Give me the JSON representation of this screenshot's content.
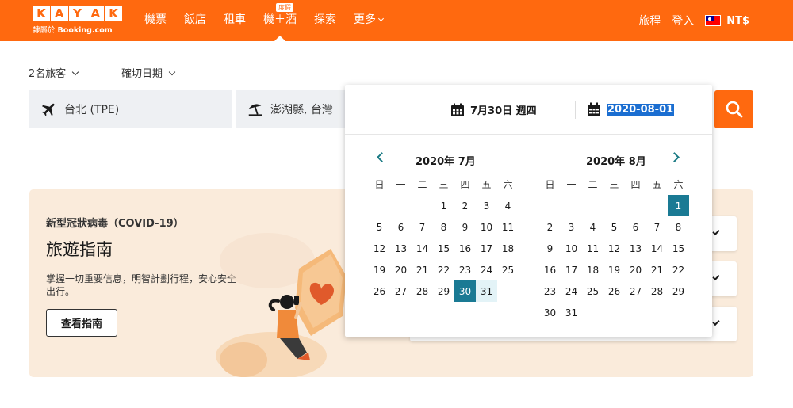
{
  "header": {
    "logo_letters": [
      "K",
      "A",
      "Y",
      "A",
      "K"
    ],
    "logo_sub_prefix": "隸屬於",
    "logo_sub_brand": "Booking.com",
    "nav": [
      {
        "label": "機票",
        "name": "nav-flights"
      },
      {
        "label": "飯店",
        "name": "nav-hotels"
      },
      {
        "label": "租車",
        "name": "nav-cars"
      },
      {
        "label": "機＋酒",
        "name": "nav-packages",
        "badge": "度假",
        "active": true
      },
      {
        "label": "探索",
        "name": "nav-explore"
      },
      {
        "label": "更多",
        "name": "nav-more",
        "dropdown": true
      }
    ],
    "trips": "旅程",
    "login": "登入",
    "currency": "NT$",
    "brand_color": "#ff690f"
  },
  "options": {
    "travelers": "2名旅客",
    "exact_dates": "確切日期"
  },
  "search": {
    "origin": "台北 (TPE)",
    "destination": "澎湖縣, 台灣",
    "origin_icon": "airplane-icon",
    "destination_icon": "beach-umbrella-icon"
  },
  "banner": {
    "kicker": "新型冠狀病毒（COVID-19）",
    "title": "旅遊指南",
    "description": "掌握一切重要信息，明智計劃行程，安心安全出行。",
    "button": "查看指南"
  },
  "datepicker": {
    "start_date": "7月30日 週四",
    "end_date": "2020-08-01",
    "weekdays": [
      "日",
      "一",
      "二",
      "三",
      "四",
      "五",
      "六"
    ],
    "months": [
      {
        "title": "2020年 7月",
        "days": [
          "",
          "",
          "",
          "1",
          "2",
          "3",
          "4",
          "5",
          "6",
          "7",
          "8",
          "9",
          "10",
          "11",
          "12",
          "13",
          "14",
          "15",
          "16",
          "17",
          "18",
          "19",
          "20",
          "21",
          "22",
          "23",
          "24",
          "25",
          "26",
          "27",
          "28",
          "29",
          "30",
          "31"
        ],
        "selected": [
          "30"
        ],
        "range": [
          "31"
        ]
      },
      {
        "title": "2020年 8月",
        "days": [
          "",
          "",
          "",
          "",
          "",
          "",
          "1",
          "2",
          "3",
          "4",
          "5",
          "6",
          "7",
          "8",
          "9",
          "10",
          "11",
          "12",
          "13",
          "14",
          "15",
          "16",
          "17",
          "18",
          "19",
          "20",
          "21",
          "22",
          "23",
          "24",
          "25",
          "26",
          "27",
          "28",
          "29",
          "30",
          "31"
        ],
        "selected": [
          "1"
        ],
        "range": []
      }
    ],
    "selected_color": "#1a7a94",
    "range_color": "#e3f3f7"
  }
}
